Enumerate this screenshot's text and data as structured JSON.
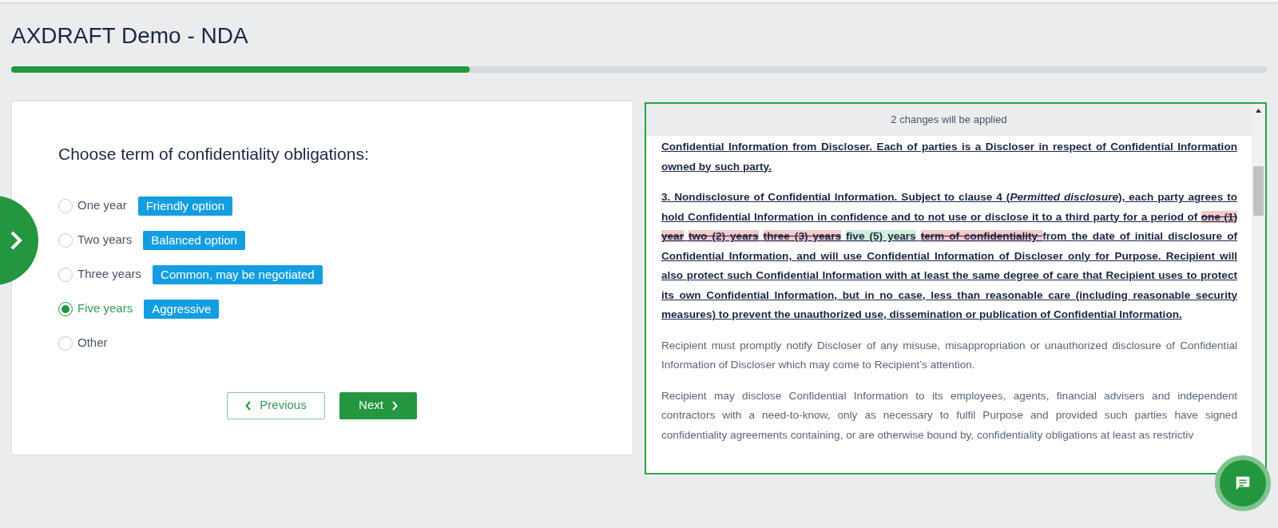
{
  "title": "AXDRAFT Demo - NDA",
  "progress": {
    "level": 0.365
  },
  "question": {
    "prompt": "Choose term of confidentiality obligations:",
    "options": [
      {
        "label": "One year",
        "badge": "Friendly option",
        "selected": false
      },
      {
        "label": "Two years",
        "badge": "Balanced option",
        "selected": false
      },
      {
        "label": "Three years",
        "badge": "Common, may be negotiated",
        "selected": false
      },
      {
        "label": "Five years",
        "badge": "Aggressive",
        "selected": true
      },
      {
        "label": "Other",
        "selected": false
      }
    ],
    "previous": "Previous",
    "next": "Next"
  },
  "document": {
    "notice": "2 changes will be applied",
    "clauses": [
      {
        "kind": "changed",
        "parts": [
          {
            "kind": "text",
            "text": "Confidential Information from Discloser. Each of parties is a Discloser in respect of Confidential Information owned by such party."
          }
        ]
      },
      {
        "kind": "changed",
        "parts": [
          {
            "kind": "text",
            "text": "3. Nondisclosure of Confidential Information. Subject to clause 4 ("
          },
          {
            "kind": "italic",
            "text": "Permitted disclosure"
          },
          {
            "kind": "text",
            "text": "), each party agrees to hold Confidential Information in confidence and to not use or disclose it to a third party for a period of "
          },
          {
            "kind": "deleted",
            "text": "one (1) year"
          },
          {
            "kind": "gap"
          },
          {
            "kind": "deleted",
            "text": "two (2) years"
          },
          {
            "kind": "gap"
          },
          {
            "kind": "deleted",
            "text": "three (3) years"
          },
          {
            "kind": "gap"
          },
          {
            "kind": "inserted",
            "text": "five (5) years"
          },
          {
            "kind": "gap"
          },
          {
            "kind": "deleted",
            "text": " term of confidentiality "
          },
          {
            "kind": "text",
            "text": " from the date of initial disclosure of Confidential Information, and will use Confidential Information of Discloser only for Purpose. Recipient will also protect such Confidential Information with at least the same degree of care that Recipient uses to protect its own Confidential Information, but in no case, less than reasonable care (including reasonable security measures) to prevent the unauthorized use, dissemination or publication of Confidential Information."
          }
        ]
      },
      {
        "kind": "plain",
        "parts": [
          {
            "kind": "text",
            "text": "Recipient must promptly notify Discloser of any misuse, misappropriation or unauthorized disclosure of Confidential Information of Discloser which may come to Recipient’s attention."
          }
        ]
      },
      {
        "kind": "plain",
        "parts": [
          {
            "kind": "text",
            "text": "Recipient may disclose Confidential Information to its employees, agents, financial advisers and independent contractors with a need-to-know, only as necessary to fulfil Purpose and provided such parties have signed confidentiality agreements containing, or are otherwise bound by, confidentiality obligations at least as restrictiv"
          }
        ]
      }
    ]
  }
}
